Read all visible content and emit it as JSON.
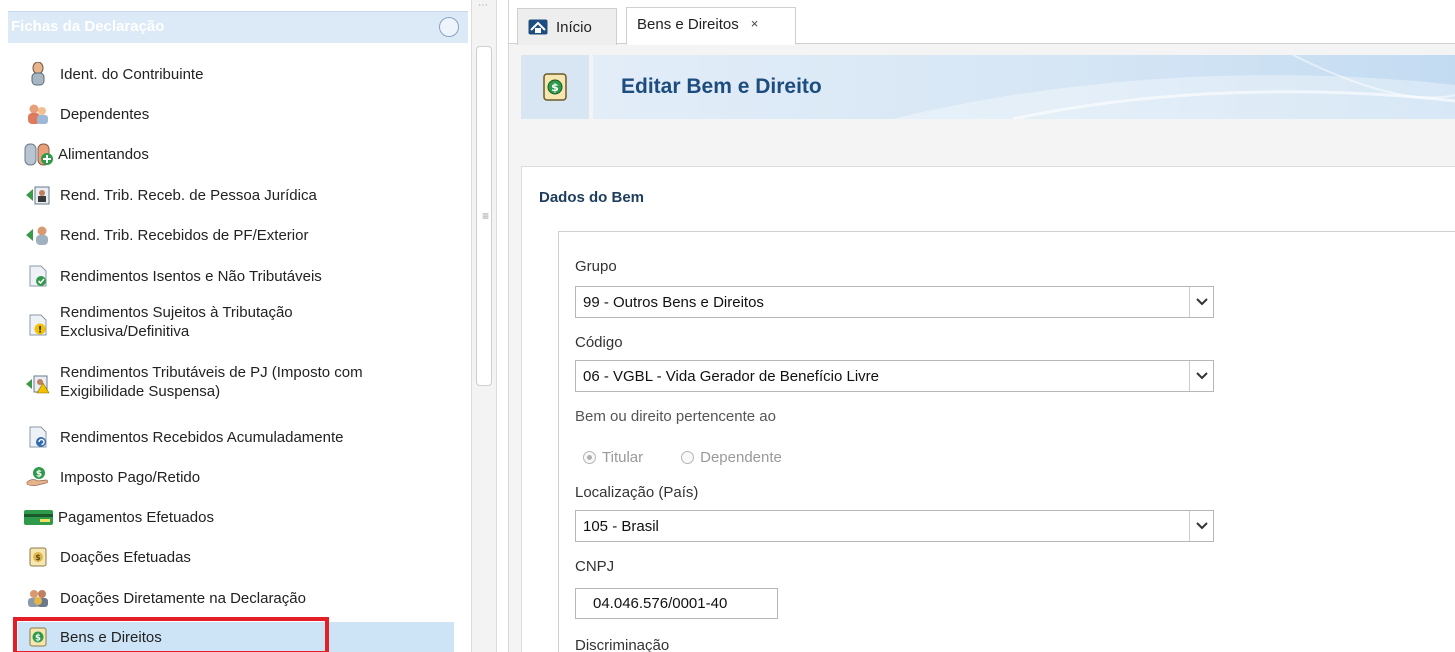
{
  "sidebar": {
    "title": "Fichas da Declaração",
    "items": [
      {
        "label": "Ident. do Contribuinte",
        "icon": "person-icon"
      },
      {
        "label": "Dependentes",
        "icon": "dependents-icon"
      },
      {
        "label": "Alimentandos",
        "icon": "alimentandos-icon"
      },
      {
        "label": "Rend. Trib. Receb. de Pessoa Jurídica",
        "icon": "income-pj-icon"
      },
      {
        "label": "Rend. Trib. Recebidos de PF/Exterior",
        "icon": "income-pf-icon"
      },
      {
        "label": "Rendimentos Isentos e Não Tributáveis",
        "icon": "exempt-income-icon"
      },
      {
        "label": "Rendimentos Sujeitos à Tributação",
        "label2": "Exclusiva/Definitiva",
        "icon": "exclusive-taxation-icon"
      },
      {
        "label": "Rendimentos Tributáveis de PJ (Imposto com",
        "label2": "Exigibilidade Suspensa)",
        "icon": "suspended-tax-icon"
      },
      {
        "label": "Rendimentos Recebidos Acumuladamente",
        "icon": "accumulated-income-icon"
      },
      {
        "label": "Imposto Pago/Retido",
        "icon": "tax-paid-icon"
      },
      {
        "label": "Pagamentos Efetuados",
        "icon": "payments-card-icon"
      },
      {
        "label": "Doações Efetuadas",
        "icon": "donations-icon"
      },
      {
        "label": "Doações Diretamente na Declaração",
        "icon": "direct-donations-icon"
      },
      {
        "label": "Bens e Direitos",
        "icon": "assets-icon"
      }
    ]
  },
  "tabs": {
    "home_label": "Início",
    "active_label": "Bens e Direitos",
    "close_glyph": "×"
  },
  "banner": {
    "title": "Editar Bem e Direito"
  },
  "form": {
    "section_title": "Dados do Bem",
    "grupo_label": "Grupo",
    "grupo_value": "99 - Outros Bens e Direitos",
    "codigo_label": "Código",
    "codigo_value": "06 - VGBL - Vida Gerador de Benefício Livre",
    "pertence_label": "Bem ou direito pertencente ao",
    "radio_titular": "Titular",
    "radio_dependente": "Dependente",
    "localizacao_label": "Localização (País)",
    "localizacao_value": "105 - Brasil",
    "cnpj_label": "CNPJ",
    "cnpj_value": "04.046.576/0001-40",
    "discriminacao_label": "Discriminação"
  },
  "colors": {
    "selection_bg": "#cde4f6",
    "highlight_border": "#e41e26",
    "title_blue": "#1d4d7e"
  }
}
